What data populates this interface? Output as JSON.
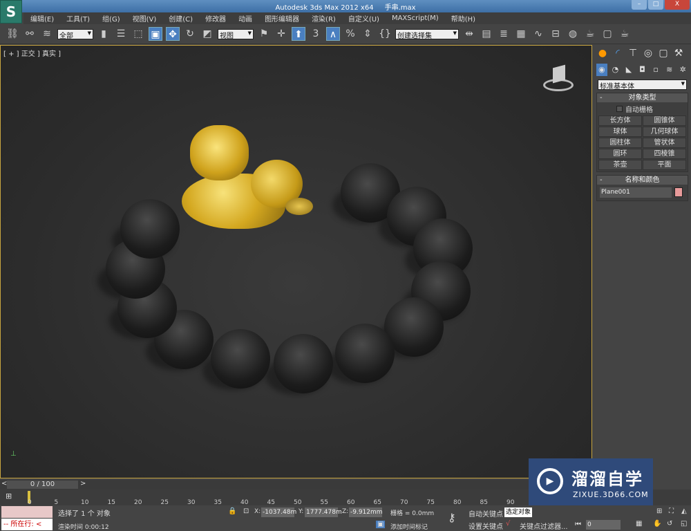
{
  "title": {
    "app": "Autodesk 3ds Max  2012 x64",
    "file": "手串.max"
  },
  "menu": [
    "编辑(E)",
    "工具(T)",
    "组(G)",
    "视图(V)",
    "创建(C)",
    "修改器",
    "动画",
    "图形编辑器",
    "渲染(R)",
    "自定义(U)",
    "MAXScript(M)",
    "帮助(H)"
  ],
  "toolbar": {
    "filter": "全部",
    "coord": "视图",
    "selset": "创建选择集",
    "snap": "3"
  },
  "viewport": {
    "label": "[ + ] 正交 ] 真实 ]",
    "border_color": "#c9a640"
  },
  "command_panel": {
    "category": "标准基本体",
    "object_type_title": "对象类型",
    "autogrid": "自动栅格",
    "buttons": [
      "长方体",
      "圆锥体",
      "球体",
      "几何球体",
      "圆柱体",
      "管状体",
      "圆环",
      "四棱锥",
      "茶壶",
      "平面"
    ],
    "name_color_title": "名称和颜色",
    "object_name": "Plane001",
    "object_color": "#e89a9a"
  },
  "timeline": {
    "position": "0 / 100",
    "ticks": [
      0,
      5,
      10,
      15,
      20,
      25,
      30,
      35,
      40,
      45,
      50,
      55,
      60,
      65,
      70,
      75,
      80,
      85,
      90
    ]
  },
  "status": {
    "selection": "选择了 1 个 对象",
    "render_time": "渲染时间  0:00:12",
    "x": "-1037.48m",
    "y": "1777.478m",
    "z": "-9.912mm",
    "grid": "栅格 = 0.0mm",
    "add_time_tag": "添加时间标记",
    "auto_key": "自动关键点",
    "set_key": "设置关键点",
    "key_mode": "选定对象",
    "key_filters": "关键点过滤器...",
    "frame": "0",
    "listener": "-- 所在行: <"
  },
  "watermark": {
    "brand": "溜溜自学",
    "url": "ZIXUE.3D66.COM"
  }
}
